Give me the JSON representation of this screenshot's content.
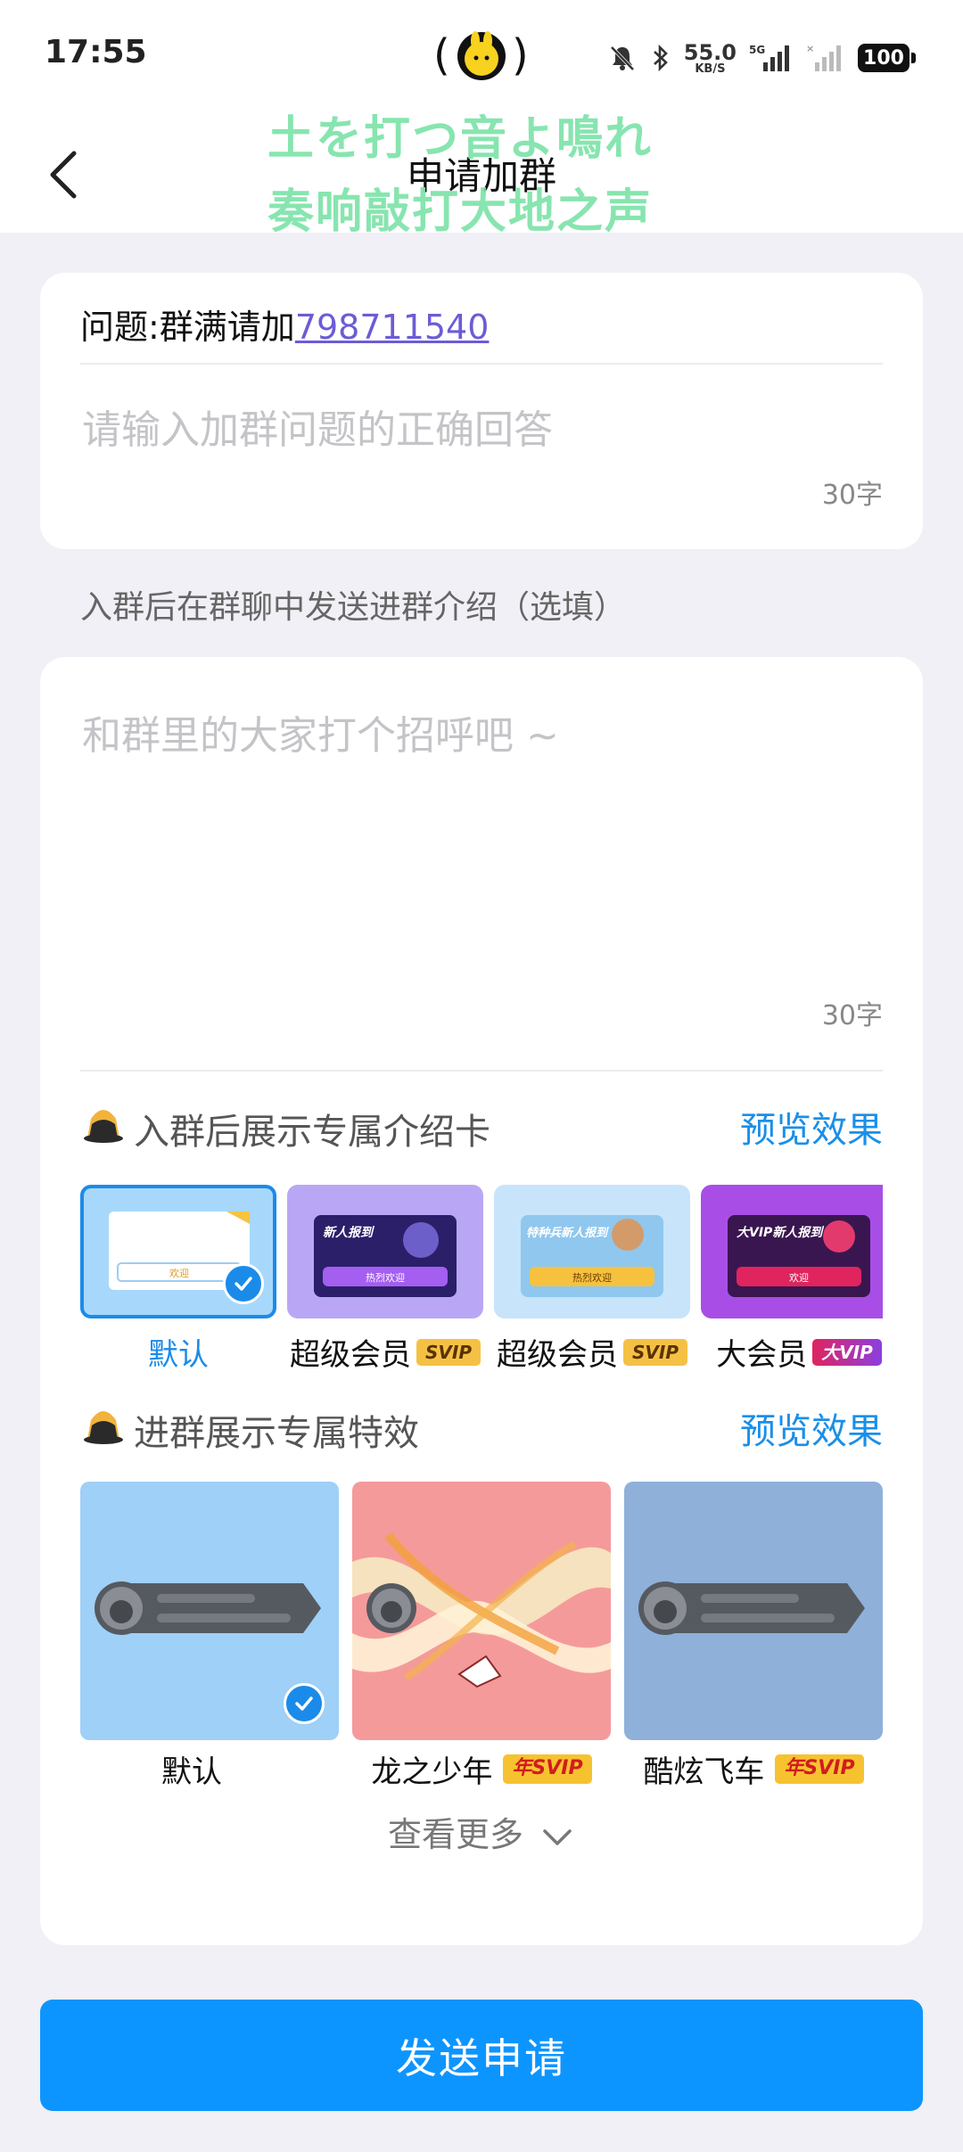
{
  "status_bar": {
    "time": "17:55",
    "net_speed": "55.0",
    "net_unit": "KB/S",
    "network_tag": "5G",
    "battery": "100"
  },
  "nav": {
    "title": "申请加群"
  },
  "overlay_lyrics": [
    "土を打つ音よ鳴れ",
    "奏响敲打大地之声"
  ],
  "question": {
    "label": "问题:群满请加",
    "link_number": "798711540",
    "answer_placeholder": "请输入加群问题的正确回答",
    "char_limit": "30字"
  },
  "intro_section_label": "入群后在群聊中发送进群介绍（选填）",
  "intro": {
    "placeholder": "和群里的大家打个招呼吧 ~",
    "char_limit": "30字"
  },
  "intro_cards": {
    "title": "入群后展示专属介绍卡",
    "preview": "预览效果",
    "options": [
      {
        "label": "默认",
        "badge": "",
        "thumb_text": "欢迎"
      },
      {
        "label": "超级会员",
        "badge": "SVIP",
        "thumb_title": "新人报到",
        "thumb_btn": "热烈欢迎"
      },
      {
        "label": "超级会员",
        "badge": "SVIP",
        "thumb_title": "特种兵新人报到",
        "thumb_btn": "热烈欢迎"
      },
      {
        "label": "大会员",
        "badge": "大VIP",
        "thumb_title": "大VIP新人报到",
        "thumb_btn": "欢迎"
      }
    ]
  },
  "effects": {
    "title": "进群展示专属特效",
    "preview": "预览效果",
    "options": [
      {
        "label": "默认",
        "badge": ""
      },
      {
        "label": "龙之少年",
        "badge": "年SVIP"
      },
      {
        "label": "酷炫飞车",
        "badge": "年SVIP"
      }
    ],
    "more": "查看更多"
  },
  "send_button": "发送申请",
  "colors": {
    "accent": "#0d95ff",
    "link": "#6b5cd6",
    "lyrics": "#7de3a9",
    "background": "#f0f0f6"
  }
}
